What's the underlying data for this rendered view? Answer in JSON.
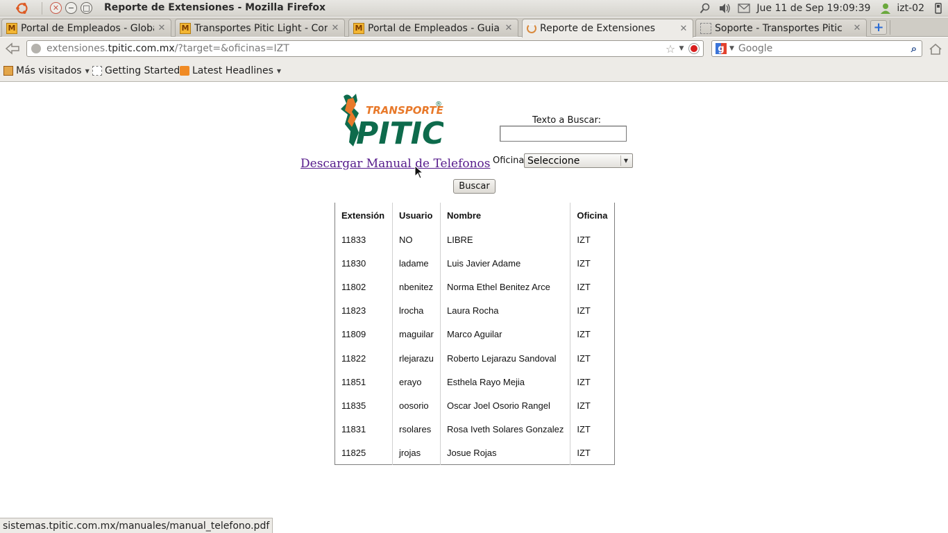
{
  "window": {
    "title": "Reporte de Extensiones - Mozilla Firefox",
    "clock": "Jue 11 de Sep 19:09:39",
    "user": "izt-02"
  },
  "tabs": [
    {
      "label": "Portal de Empleados - Global ...",
      "icon": "m-favicon"
    },
    {
      "label": "Transportes Pitic Light - Contr...",
      "icon": "m-favicon"
    },
    {
      "label": "Portal de Empleados - Guia po...",
      "icon": "m-favicon"
    },
    {
      "label": "Reporte de Extensiones",
      "icon": "loading-icon",
      "active": true
    },
    {
      "label": "Soporte - Transportes Pitic",
      "icon": "blank-page-icon"
    }
  ],
  "nav": {
    "url_prefix": "extensiones.",
    "url_domain": "tpitic.com.mx",
    "url_path": "/?target=&oficinas=IZT",
    "search_placeholder": "Google"
  },
  "bookmarks": [
    {
      "label": "Más visitados",
      "dropdown": true
    },
    {
      "label": "Getting Started",
      "dropdown": false
    },
    {
      "label": "Latest Headlines",
      "dropdown": true
    }
  ],
  "page": {
    "logo_small_text": "TRANSPORTES",
    "logo_big_text": "PITIC",
    "logo_mark": "®",
    "manual_link": "Descargar Manual de Telefonos",
    "search_label": "Texto a Buscar:",
    "search_value": "",
    "oficina_label": "Oficina",
    "oficina_selected": "Seleccione",
    "buscar_label": "Buscar"
  },
  "table": {
    "headers": [
      "Extensión",
      "Usuario",
      "Nombre",
      "Oficina"
    ],
    "rows": [
      [
        "11833",
        "NO",
        "LIBRE",
        "IZT"
      ],
      [
        "11830",
        "ladame",
        "Luis Javier Adame",
        "IZT"
      ],
      [
        "11802",
        "nbenitez",
        "Norma Ethel Benitez Arce",
        "IZT"
      ],
      [
        "11823",
        "lrocha",
        "Laura Rocha",
        "IZT"
      ],
      [
        "11809",
        "maguilar",
        "Marco Aguilar",
        "IZT"
      ],
      [
        "11822",
        "rlejarazu",
        "Roberto Lejarazu Sandoval",
        "IZT"
      ],
      [
        "11851",
        "erayo",
        "Esthela Rayo Mejia",
        "IZT"
      ],
      [
        "11835",
        "oosorio",
        "Oscar Joel Osorio Rangel",
        "IZT"
      ],
      [
        "11831",
        "rsolares",
        "Rosa Iveth Solares Gonzalez",
        "IZT"
      ],
      [
        "11825",
        "jrojas",
        "Josue Rojas",
        "IZT"
      ]
    ]
  },
  "status": {
    "text": "sistemas.tpitic.com.mx/manuales/manual_telefono.pdf"
  },
  "colors": {
    "link_visited": "#551a8b",
    "logo_orange": "#e8792a",
    "logo_green": "#0e6b4c"
  }
}
